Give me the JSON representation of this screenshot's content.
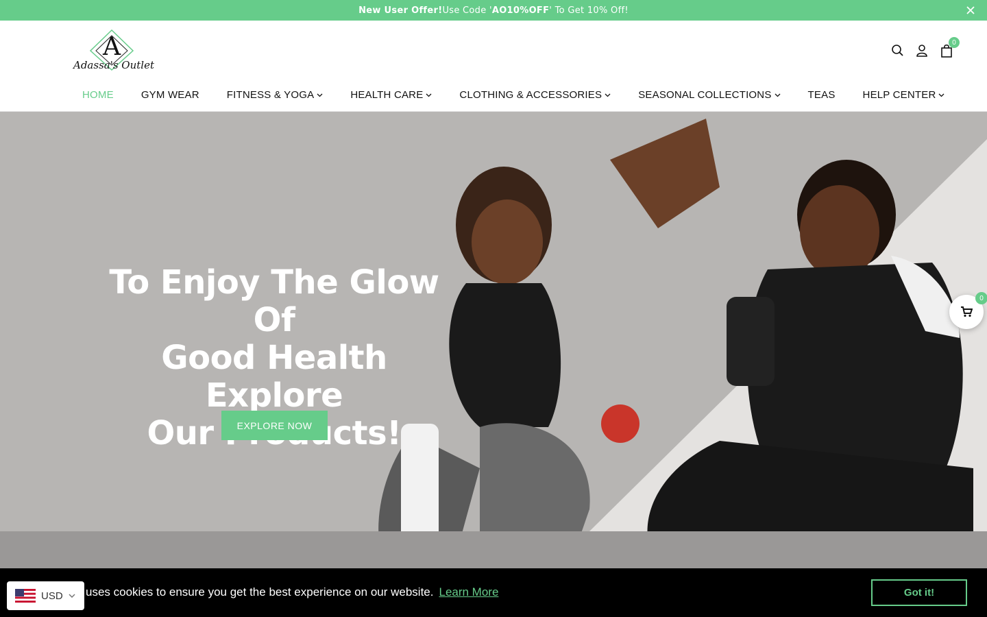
{
  "announcement": {
    "bold": "New User Offer!",
    "text_a": " Use Code '",
    "code": "AO10%OFF",
    "text_b": "' To Get 10% Off!"
  },
  "brand": {
    "logo_letter": "A",
    "logo_text": "Adassa's Outlet"
  },
  "header": {
    "cart_count": "0"
  },
  "nav": {
    "items": [
      {
        "label": "HOME",
        "dropdown": false,
        "active": true
      },
      {
        "label": "GYM WEAR",
        "dropdown": false
      },
      {
        "label": "FITNESS & YOGA",
        "dropdown": true
      },
      {
        "label": "HEALTH CARE",
        "dropdown": true
      },
      {
        "label": "CLOTHING & ACCESSORIES",
        "dropdown": true
      },
      {
        "label": "SEASONAL COLLECTIONS",
        "dropdown": true
      },
      {
        "label": "TEAS",
        "dropdown": false
      },
      {
        "label": "HELP CENTER",
        "dropdown": true
      }
    ]
  },
  "hero": {
    "title_line1": "To Enjoy The Glow Of",
    "title_line2": "Good Health Explore",
    "title_line3": "Our Products!",
    "button": "EXPLORE NOW"
  },
  "floating_cart": {
    "count": "0"
  },
  "cookie": {
    "message": "uses cookies to ensure you get the best experience on our website.",
    "link": "Learn More",
    "button": "Got it!"
  },
  "currency": {
    "code": "USD"
  },
  "colors": {
    "accent": "#66cc8a",
    "hero_bg": "#b7b5b3",
    "cookie_bg": "#000000"
  }
}
